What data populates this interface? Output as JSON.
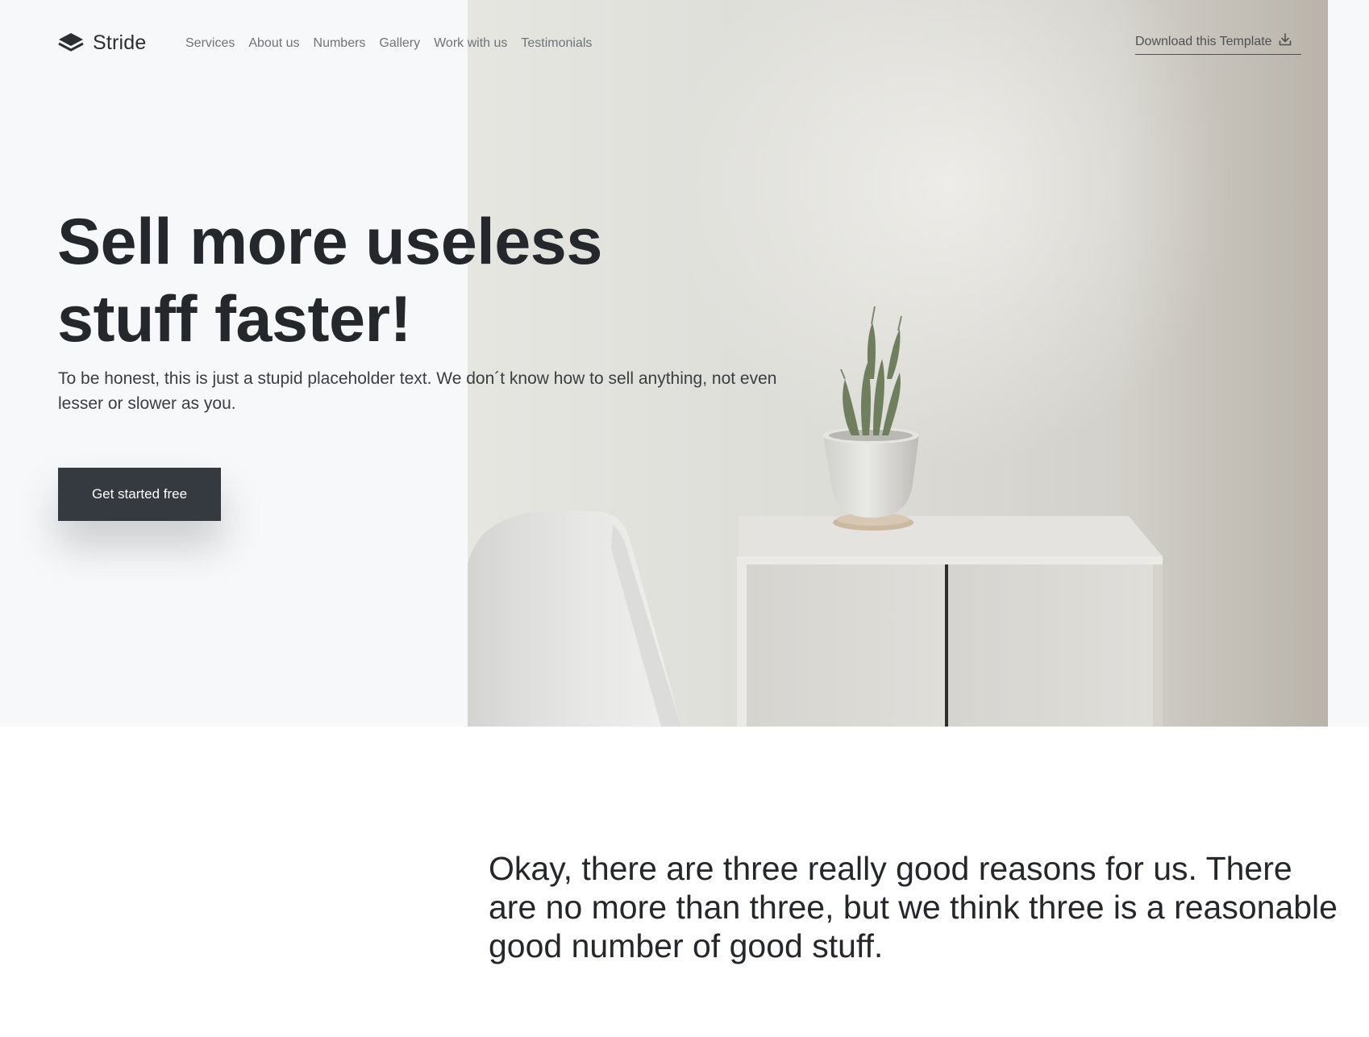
{
  "brand": {
    "name": "Stride",
    "logo_icon": "layers-icon"
  },
  "nav": {
    "items": [
      {
        "label": "Services"
      },
      {
        "label": "About us"
      },
      {
        "label": "Numbers"
      },
      {
        "label": "Gallery"
      },
      {
        "label": "Work with us"
      },
      {
        "label": "Testimonials"
      }
    ]
  },
  "header": {
    "download_label": "Download this Template",
    "download_icon": "download-icon"
  },
  "hero": {
    "headline_line1": "Sell more useless",
    "headline_line2": "stuff faster!",
    "subtext": "To be honest, this is just a stupid placeholder text. We don´t know how to sell anything, not even lesser or slower as you.",
    "cta_label": "Get started free",
    "image": "photo-chair-cabinet-cactus"
  },
  "reasons": {
    "text": "Okay, there are three really good reasons for us. There are no more than three, but we think three is a reasonable good number of good stuff."
  },
  "colors": {
    "hero_bg": "#f7f8fa",
    "text_dark": "#24272c",
    "button_bg": "#353a40",
    "nav_text": "#6f7378"
  }
}
